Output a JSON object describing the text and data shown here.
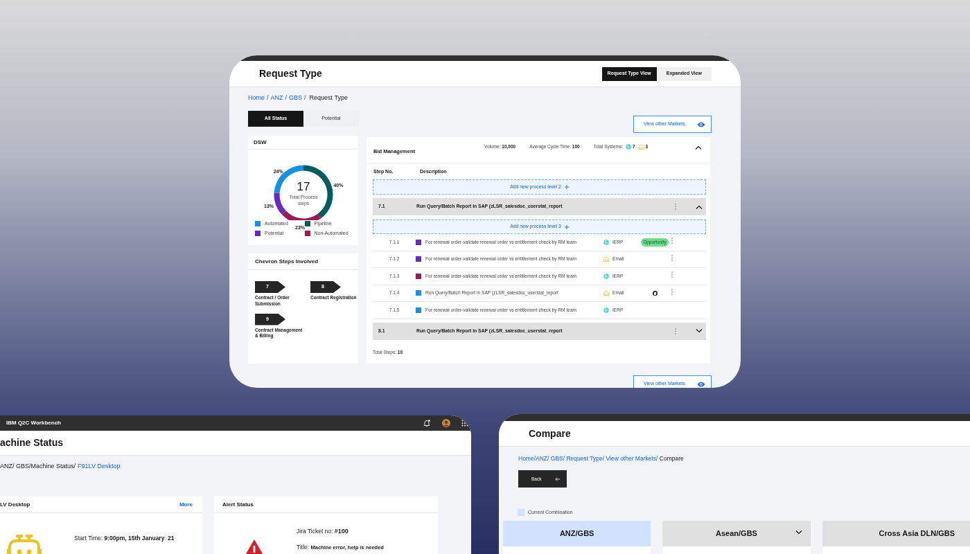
{
  "request_type_window": {
    "title": "Request Type",
    "view_toggle": [
      {
        "label": "Request Type View",
        "selected": true
      },
      {
        "label": "Expanded View",
        "selected": false
      }
    ],
    "breadcrumb": {
      "links": [
        "Home",
        "ANZ",
        "GBS"
      ],
      "separator": "/",
      "current": "Request Type"
    },
    "status_tabs": [
      {
        "label": "All Status",
        "selected": true
      },
      {
        "label": "Potential",
        "selected": false
      }
    ],
    "markets_buttons": [
      "View other Markets",
      "View other Markets"
    ],
    "dsw_card": {
      "title": "DSW",
      "center_value": "17",
      "center_label": "Total Process steps",
      "chart_data": {
        "type": "donut",
        "categories": [
          "Pipeline",
          "Non-Automated",
          "Potential",
          "Automated"
        ],
        "values": [
          40,
          23,
          13,
          24
        ],
        "colors": [
          "#005d5d",
          "#9f1853",
          "#6929c4",
          "#1192e8"
        ],
        "value_labels": [
          "40%",
          "23%",
          "13%",
          "24%"
        ]
      }
    },
    "chevron_card": {
      "title": "Chevron Steps Involved",
      "steps": [
        {
          "number": "7",
          "label": "Contract / Order Submission"
        },
        {
          "number": "8",
          "label": "Contract Registration"
        },
        {
          "number": "9",
          "label": "Contract Management & Billing"
        }
      ]
    },
    "process_card": {
      "title": "Bid Management",
      "expanded": true,
      "stats": [
        {
          "label": "Volume:",
          "value": "10,000"
        },
        {
          "label": "Average Cycle Time:",
          "value": "100"
        }
      ],
      "systems": {
        "label": "Total Systems:",
        "items": [
          {
            "kind": "erp",
            "count": "7"
          },
          {
            "kind": "email",
            "count": "3"
          }
        ]
      },
      "columns": [
        "Step No.",
        "Description"
      ],
      "add_level_label": "Add new process level 2",
      "groups": [
        {
          "number": "7.1",
          "title": "Run Query/Batch Report in SAP (zLSR_salesdoc_userstat_report",
          "expanded": true,
          "add_level_label": "Add new process level 3",
          "steps": [
            {
              "number": "7.1.1",
              "color": "#6929c4",
              "description": "For renewal order-validate renewal order vs entitlement check by RM team",
              "system": {
                "kind": "erp",
                "label": "IERP"
              },
              "tag": "Opportunity",
              "linked": false,
              "menu": true
            },
            {
              "number": "7.1.2",
              "color": "#6929c4",
              "description": "For renewal order-validate renewal order vs entitlement check by RM team",
              "system": {
                "kind": "email",
                "label": "Email"
              },
              "linked": false,
              "menu": true
            },
            {
              "number": "7.1.3",
              "color": "#9f1853",
              "description": "For renewal order-validate renewal order vs entitlement check by RM team",
              "system": {
                "kind": "erp",
                "label": "IERP"
              },
              "linked": false,
              "menu": true
            },
            {
              "number": "7.1.4",
              "color": "#1192e8",
              "description": "Run Query/Batch Report in SAP (zLSR_salesdoc_userstat_report",
              "system": {
                "kind": "email",
                "label": "Email"
              },
              "linked": true,
              "menu": true
            },
            {
              "number": "7.1.5",
              "color": "#1192e8",
              "description": "For renewal order-validate renewal order vs entitlement check by RM team",
              "system": {
                "kind": "erp",
                "label": "IERP"
              },
              "linked": false,
              "menu": false
            }
          ]
        },
        {
          "number": "8.1",
          "title": "Run Query/Batch Report in SAP (zLSR_salesdoc_userstat_report",
          "expanded": false
        }
      ],
      "total": {
        "label": "Total Steps:",
        "value": "10"
      }
    }
  },
  "machine_status_window": {
    "app_name": "IBM Q2C Workbench",
    "title": "achine Status",
    "breadcrumb": {
      "path": "ANZ/ GBS/Machine Status/",
      "current": "F91LV Desktop"
    },
    "device_card": {
      "title": "LV Desktop",
      "action": "More",
      "fields": [
        {
          "label": "Start Time:",
          "value": "9:00pm, 15th January  21"
        }
      ]
    },
    "alert_card": {
      "title": "Alert Status",
      "fields": [
        {
          "label": "Jira Ticket no:",
          "value": "#100"
        },
        {
          "label": "Title:",
          "value": "Machine error, help is needed"
        }
      ]
    }
  },
  "compare_window": {
    "title": "Compare",
    "breadcrumb": {
      "links": [
        "Home/",
        "ANZ/ ",
        "GBS/ ",
        "Request Type/ ",
        "View other Markets/ "
      ],
      "current": "Compare"
    },
    "back_button": "Back",
    "legend": "Current Combination",
    "columns": [
      {
        "label": "ANZ/GBS",
        "current": true,
        "dropdown": false
      },
      {
        "label": "Asean/GBS",
        "current": false,
        "dropdown": true
      },
      {
        "label": "Cross Asia DLN/GBS",
        "current": false,
        "dropdown": false
      }
    ]
  }
}
